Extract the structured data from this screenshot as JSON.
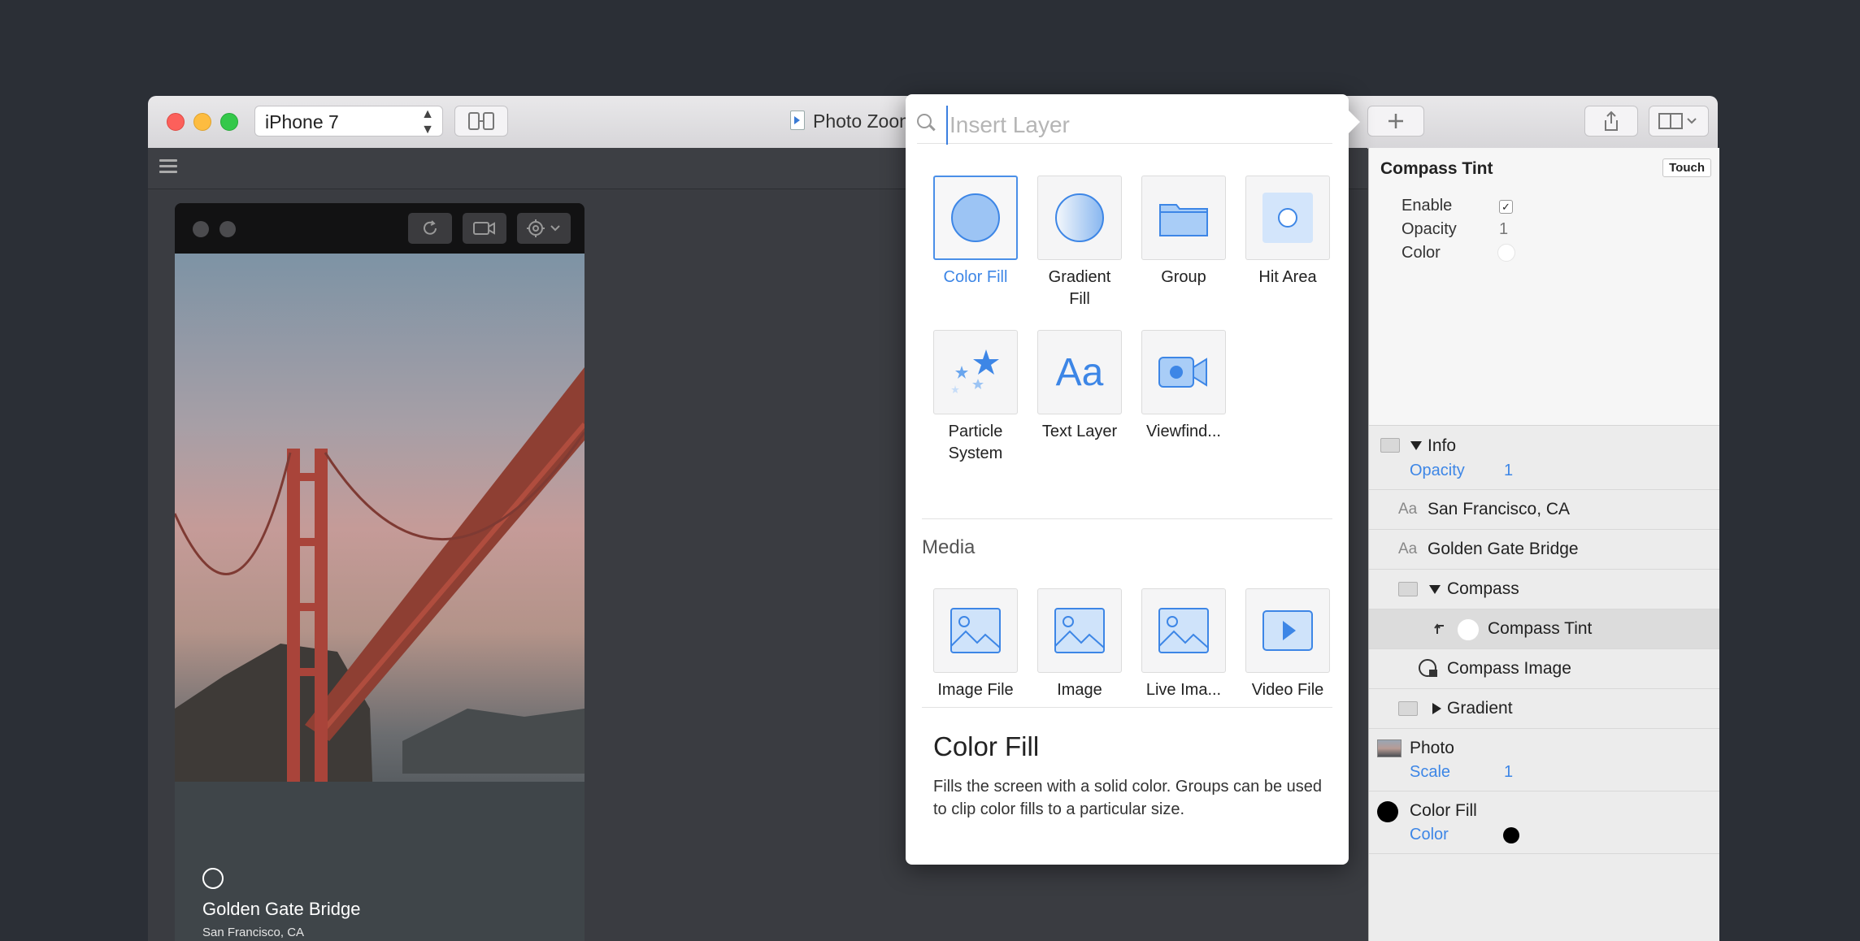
{
  "toolbar": {
    "device": "iPhone 7",
    "document_title": "Photo Zoom"
  },
  "device_preview": {
    "photo_title": "Golden Gate Bridge",
    "photo_subtitle": "San Francisco, CA"
  },
  "insert_popover": {
    "search_placeholder": "Insert Layer",
    "items": [
      {
        "label": "Color Fill",
        "icon": "color-fill-icon",
        "selected": true
      },
      {
        "label": "Gradient Fill",
        "icon": "gradient-fill-icon"
      },
      {
        "label": "Group",
        "icon": "folder-icon"
      },
      {
        "label": "Hit Area",
        "icon": "hit-area-icon"
      },
      {
        "label": "Particle System",
        "icon": "stars-icon"
      },
      {
        "label": "Text Layer",
        "icon": "text-aa-icon"
      },
      {
        "label": "Viewfind...",
        "icon": "camera-icon"
      }
    ],
    "media_header": "Media",
    "media_items": [
      {
        "label": "Image File",
        "icon": "image-icon"
      },
      {
        "label": "Image",
        "icon": "image-icon"
      },
      {
        "label": "Live Ima...",
        "icon": "image-icon"
      },
      {
        "label": "Video File",
        "icon": "play-icon"
      }
    ],
    "description_title": "Color Fill",
    "description_body": "Fills the screen with a solid color. Groups can be used to clip color fills to a particular size."
  },
  "inspector": {
    "title": "Compass Tint",
    "touch_label": "Touch",
    "props": {
      "enable_label": "Enable",
      "enable_checked": true,
      "opacity_label": "Opacity",
      "opacity_value": "1",
      "color_label": "Color"
    },
    "layers": {
      "info": {
        "name": "Info",
        "sub_label": "Opacity",
        "sub_value": "1"
      },
      "sf": {
        "name": "San Francisco, CA",
        "icon_text": "Aa"
      },
      "ggb": {
        "name": "Golden Gate Bridge",
        "icon_text": "Aa"
      },
      "compass": {
        "name": "Compass"
      },
      "compass_tint": {
        "name": "Compass Tint"
      },
      "compass_image": {
        "name": "Compass Image"
      },
      "gradient": {
        "name": "Gradient"
      },
      "photo": {
        "name": "Photo",
        "sub_label": "Scale",
        "sub_value": "1"
      },
      "color_fill": {
        "name": "Color Fill",
        "sub_label": "Color"
      }
    }
  }
}
